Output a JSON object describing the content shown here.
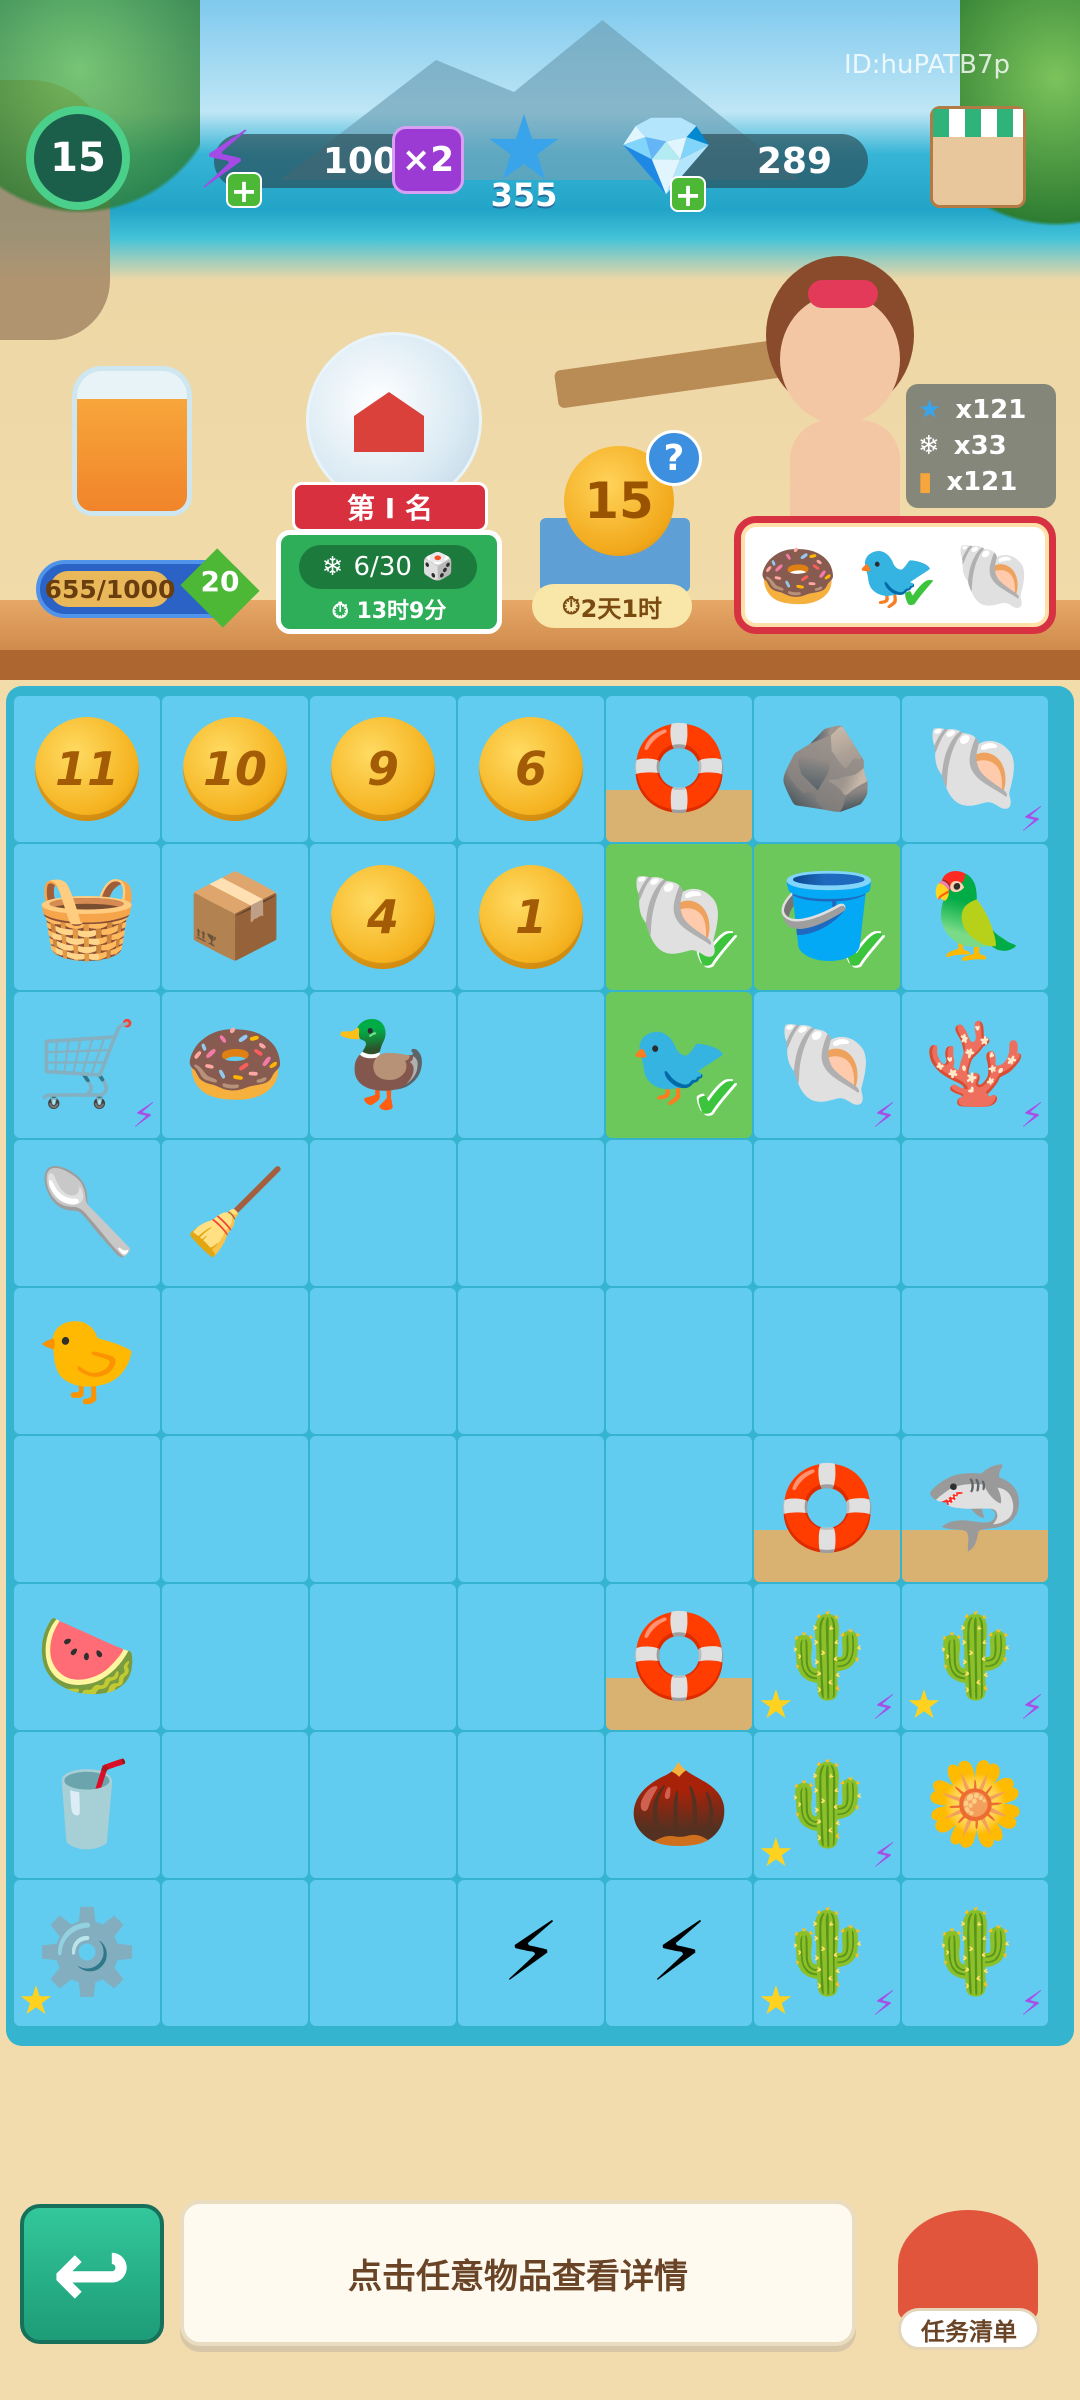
{
  "hud": {
    "level": "15",
    "energy": "100",
    "multiplier": "×2",
    "stars": "355",
    "gems": "289",
    "player_id": "ID:huPATB7p"
  },
  "jar": {
    "progress": "655/1000",
    "progress_value": 0.655,
    "level": "20"
  },
  "event": {
    "rank": "第 I 名",
    "progress": "6/30",
    "timer": "13时9分"
  },
  "coin_event": {
    "value": "15",
    "timer": "2天1时",
    "help": "?"
  },
  "rewards": {
    "star": "x121",
    "snow": "x33",
    "jar": "x121"
  },
  "order_items": [
    "donut-ring",
    "seagull",
    "shell"
  ],
  "board": {
    "rows": [
      [
        {
          "t": "coin",
          "v": "11"
        },
        {
          "t": "coin",
          "v": "10"
        },
        {
          "t": "coin",
          "v": "9"
        },
        {
          "t": "coin",
          "v": "6"
        },
        {
          "t": "item",
          "i": "swim-ring-sand",
          "g": "🛟",
          "sand": true
        },
        {
          "t": "item",
          "i": "rocks",
          "g": "🪨"
        },
        {
          "t": "item",
          "i": "starfish-coral",
          "g": "🐚",
          "bolt": true
        }
      ],
      [
        {
          "t": "item",
          "i": "beach-bag",
          "g": "🧺"
        },
        {
          "t": "item",
          "i": "sand-tray",
          "g": "📦"
        },
        {
          "t": "coin",
          "v": "4"
        },
        {
          "t": "coin",
          "v": "1"
        },
        {
          "t": "item",
          "i": "conch-shell",
          "g": "🐚",
          "hl": true,
          "check": true
        },
        {
          "t": "item",
          "i": "watering-can",
          "g": "🪣",
          "hl": true,
          "check": true
        },
        {
          "t": "item",
          "i": "parrot",
          "g": "🦜"
        }
      ],
      [
        {
          "t": "item",
          "i": "surf-cart",
          "g": "🛒",
          "bolt": true
        },
        {
          "t": "item",
          "i": "pink-donut-ring",
          "g": "🍩"
        },
        {
          "t": "item",
          "i": "rubber-duck-hat",
          "g": "🦆"
        },
        {
          "t": "empty"
        },
        {
          "t": "item",
          "i": "seagull",
          "g": "🐦",
          "hl": true,
          "check": true
        },
        {
          "t": "item",
          "i": "scallop-shell",
          "g": "🐚",
          "bolt": true
        },
        {
          "t": "item",
          "i": "coral-shell",
          "g": "🪸",
          "bolt": true
        }
      ],
      [
        {
          "t": "item",
          "i": "blue-shovel",
          "g": "🥄"
        },
        {
          "t": "item",
          "i": "sand-scoop",
          "g": "🧹"
        },
        {
          "t": "empty"
        },
        {
          "t": "empty"
        },
        {
          "t": "empty"
        },
        {
          "t": "empty"
        },
        {
          "t": "empty"
        }
      ],
      [
        {
          "t": "item",
          "i": "rubber-duck",
          "g": "🐤"
        },
        {
          "t": "empty"
        },
        {
          "t": "empty"
        },
        {
          "t": "empty"
        },
        {
          "t": "empty"
        },
        {
          "t": "empty"
        },
        {
          "t": "empty"
        }
      ],
      [
        {
          "t": "empty"
        },
        {
          "t": "empty"
        },
        {
          "t": "empty"
        },
        {
          "t": "empty"
        },
        {
          "t": "empty"
        },
        {
          "t": "item",
          "i": "swim-ring-sand",
          "g": "🛟",
          "sand": true
        },
        {
          "t": "item",
          "i": "shark-float",
          "g": "🦈",
          "sand": true
        }
      ],
      [
        {
          "t": "item",
          "i": "watermelon-juice",
          "g": "🍉"
        },
        {
          "t": "empty"
        },
        {
          "t": "empty"
        },
        {
          "t": "empty"
        },
        {
          "t": "item",
          "i": "swim-ring-sand",
          "g": "🛟",
          "sand": true
        },
        {
          "t": "item",
          "i": "cactus-planter",
          "g": "🌵",
          "star": true,
          "bolt": true
        },
        {
          "t": "item",
          "i": "cactus-planter",
          "g": "🌵",
          "star": true,
          "bolt": true
        }
      ],
      [
        {
          "t": "item",
          "i": "juice-glass",
          "g": "🥤"
        },
        {
          "t": "empty"
        },
        {
          "t": "empty"
        },
        {
          "t": "empty"
        },
        {
          "t": "item",
          "i": "seed",
          "g": "🌰"
        },
        {
          "t": "item",
          "i": "cactus-planter",
          "g": "🌵",
          "star": true,
          "bolt": true
        },
        {
          "t": "item",
          "i": "yellow-flower-pot",
          "g": "🌼"
        }
      ],
      [
        {
          "t": "item",
          "i": "juicer",
          "g": "⚙️",
          "star": true
        },
        {
          "t": "empty"
        },
        {
          "t": "empty"
        },
        {
          "t": "item",
          "i": "green-energy",
          "g": "⚡"
        },
        {
          "t": "item",
          "i": "green-energy-stack",
          "g": "⚡"
        },
        {
          "t": "item",
          "i": "cactus-pot",
          "g": "🌵",
          "star": true,
          "bolt": true
        },
        {
          "t": "item",
          "i": "cactus-pot-small",
          "g": "🌵",
          "bolt": true
        }
      ]
    ]
  },
  "footer": {
    "hint": "点击任意物品查看详情",
    "task_list": "任务清单"
  }
}
